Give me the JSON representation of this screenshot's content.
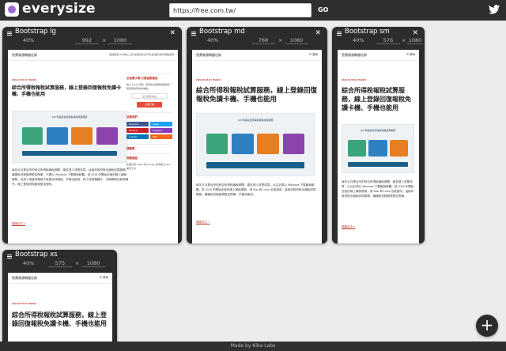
{
  "app": {
    "name": "everysize",
    "url_value": "https://free.com.tw/",
    "go_label": "GO",
    "footer_text": "Made by Kiba Labs",
    "add_label": "+"
  },
  "site": {
    "brand": "免費資源網路社群",
    "nav": "首頁精選   WP   網上工具   免費空間   技巧文章   關於我們   聯絡我們",
    "menu": "☰ 選單",
    "date": "2020-05-05 BY PEEKS",
    "title": "綜合所得稅報稅試算服務，線上登錄回復報稅免讀卡機、手機也能用",
    "image_caption": "109 年度綜合所得稅報稅試算服務",
    "body_lg": "每年五月是台灣的綜合所得稅報稅期間，繳多退少或是試算，這幾年政府推出報稅試算服務，讓報稅流程變得更加簡單，只要以 Windows 下載報稅軟體，從 2018 年開始全面的線上報稅服務，自然人憑證或健保卡就能完成報稅，手機也能用。除了使用電腦外，手機網頁也能夠操作，線上登錄回復報稅更加便利。",
    "body_md": "每年五月是台灣的綜合所得稅報稅期間，繳多退少或是試算，以往必須以 Windows 下載報稅軟體，從 2018 年開始全面的線上報稅服務，用 Mac 和 Linux 也能使用，這幾年政府推出報稅試算服務，讓報稅流程變得更加簡單，手機也能用。",
    "body_sm": "每年五月是台灣的綜合所得稅報稅期間，繳多退少或是試算，以往必須以 Windows 下載報稅軟體，從 2018 年開始全面的線上報稅服務，用 Mac 和 Linux 也能使用，這幾年政府推出報稅試算服務，讓報稅流程變得更加簡單。",
    "link_text": "線上報稅服務",
    "read_more": "閱讀全文 »",
    "sidebar": {
      "subscribe_title": "全站電子報 訂閱自動推送",
      "subscribe_text": "輸入 Email 訂閱，當有新文章發佈時將第一時間寄送到你的信箱。",
      "email_placeholder": "電子郵件地址",
      "subscribe_btn": "立即訂閱",
      "follow_title": "追蹤我們",
      "social": [
        {
          "label": "Facebook",
          "color": "#3b5998"
        },
        {
          "label": "Twitter",
          "color": "#1da1f2"
        },
        {
          "label": "Pinterest",
          "color": "#cb2027"
        },
        {
          "label": "Instagram",
          "color": "#8a3ab9"
        },
        {
          "label": "LinkedIn",
          "color": "#0077b5"
        },
        {
          "label": "RSS",
          "color": "#f26522"
        }
      ],
      "tag_title": "標籤雲",
      "links_title": "相關連結",
      "links_text": "免費資源 Adobe 與 Google 合作推出 Web 開發工具"
    }
  },
  "frames": [
    {
      "title": "Bootstrap lg",
      "zoom": "40%",
      "width": "992",
      "height": "1080",
      "x_label": "×",
      "close": "✕"
    },
    {
      "title": "Bootstrap md",
      "zoom": "40%",
      "width": "768",
      "height": "1080",
      "x_label": "×",
      "close": "✕"
    },
    {
      "title": "Bootstrap sm",
      "zoom": "40%",
      "width": "576",
      "height": "1080",
      "x_label": "×",
      "close": "✕"
    },
    {
      "title": "Bootstrap xs",
      "zoom": "40%",
      "width": "575",
      "height": "1080",
      "x_label": "×",
      "close": "✕"
    }
  ],
  "colors": {
    "topbar": "#2f2f2f",
    "frame": "#2c2c2c",
    "accent": "#c0392b",
    "image_blue": "#1a5f8a"
  }
}
